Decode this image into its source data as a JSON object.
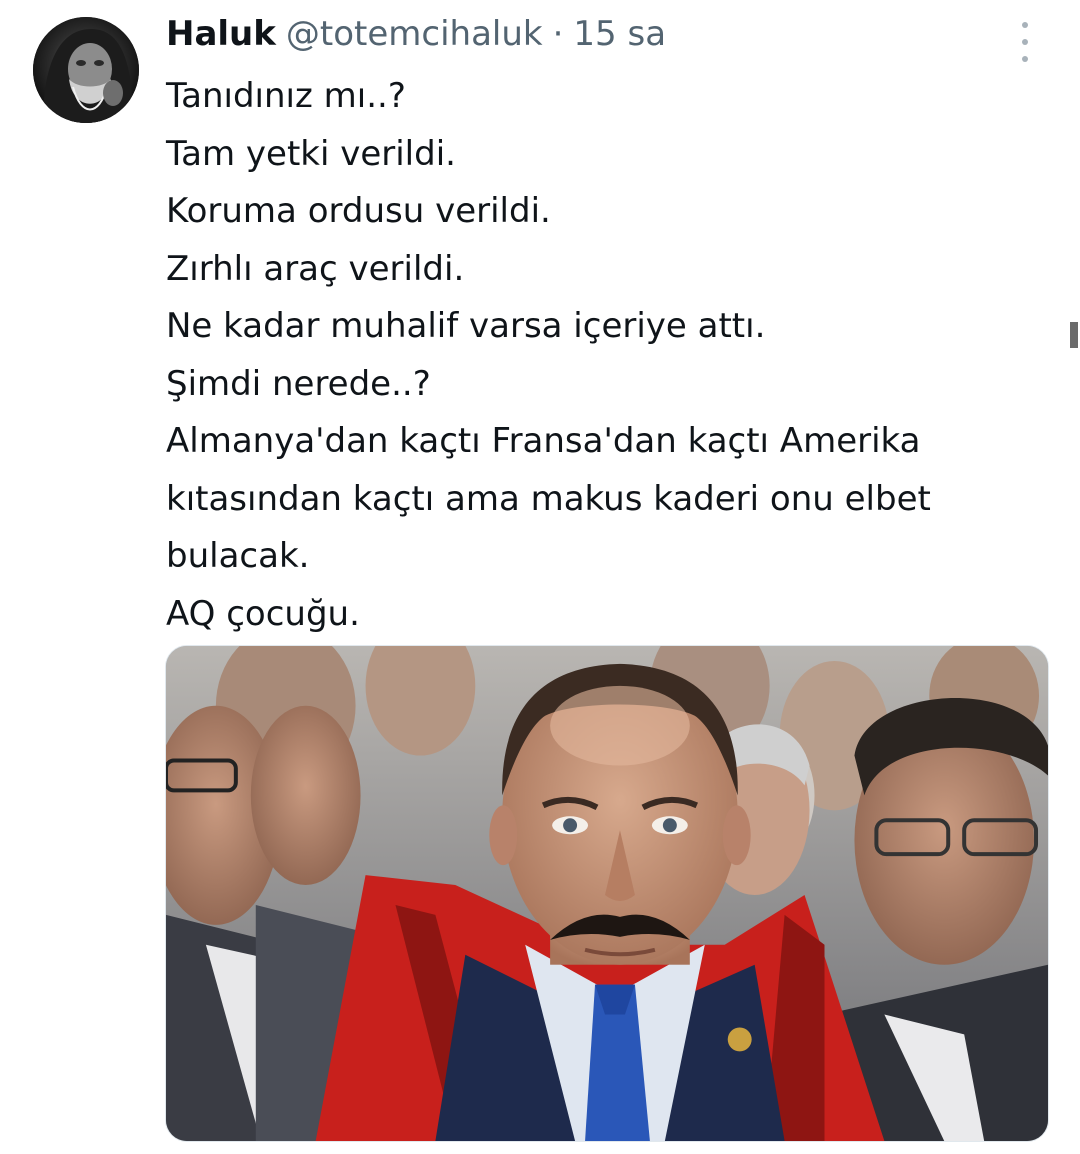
{
  "tweet": {
    "author": {
      "display_name": "Haluk",
      "handle": "@totemcihaluk",
      "separator": "·",
      "time": "15 sa",
      "avatar_icon": "bearded-old-man-avatar"
    },
    "more_icon": "vertical-ellipsis-icon",
    "lines": [
      "Tanıdınız mı..?",
      "Tam yetki verildi.",
      "Koruma ordusu verildi.",
      "Zırhlı araç verildi.",
      "Ne kadar muhalif varsa içeriye attı.",
      "Şimdi nerede..?",
      "Almanya'dan kaçtı Fransa'dan kaçtı Amerika",
      "kıtasından kaçtı ama makus kaderi onu elbet",
      "bulacak.",
      "AQ çocuğu."
    ],
    "media": {
      "kind": "photo"
    }
  },
  "colors": {
    "text_primary": "#0f1419",
    "text_secondary": "#536471",
    "robe_red": "#c8201c",
    "background": "#ffffff"
  }
}
